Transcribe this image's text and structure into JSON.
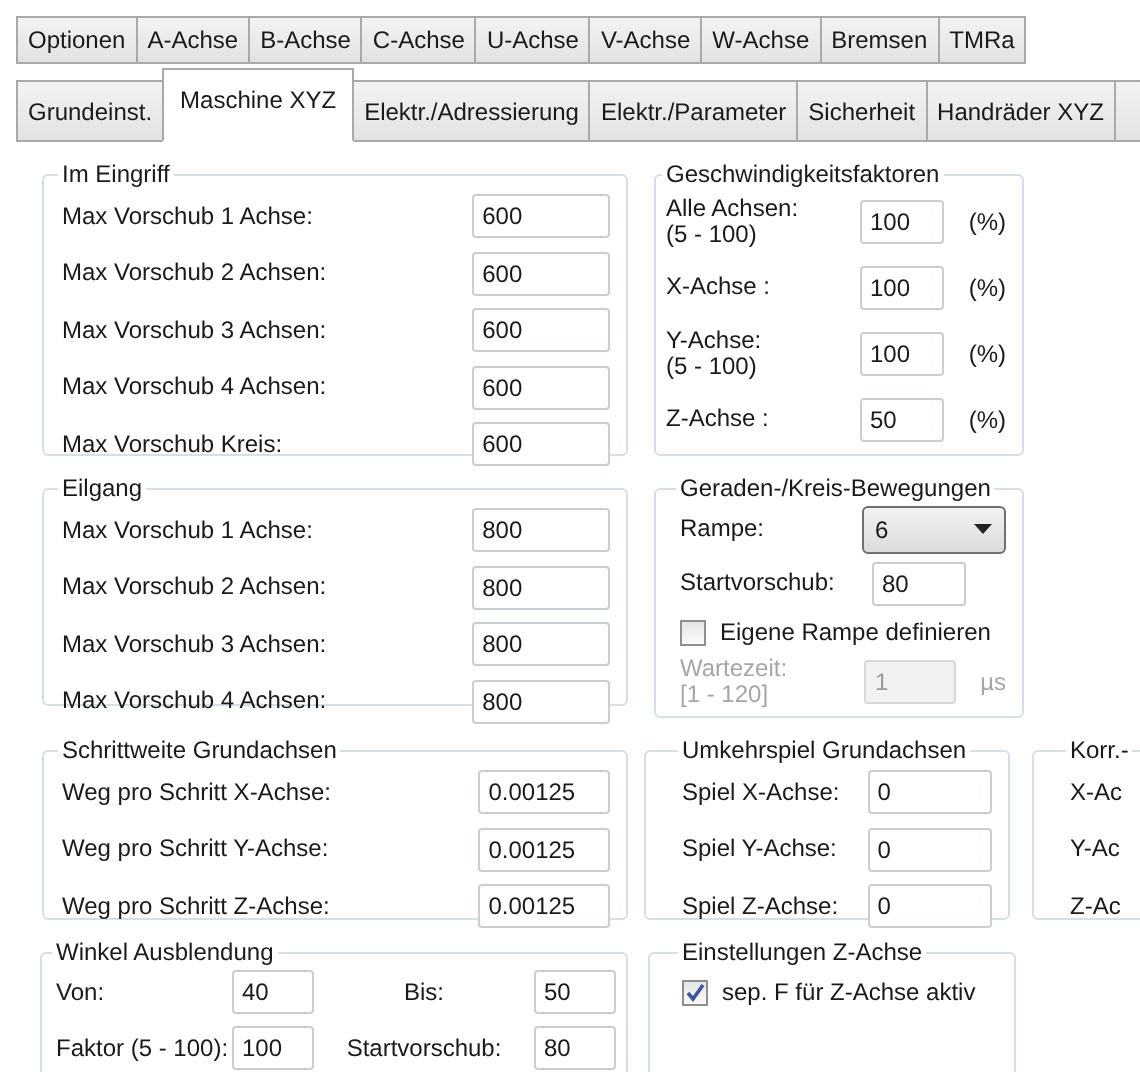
{
  "tabs_row_1": [
    {
      "label": "Optionen",
      "selected": false
    },
    {
      "label": "A-Achse",
      "selected": false
    },
    {
      "label": "B-Achse",
      "selected": false
    },
    {
      "label": "C-Achse",
      "selected": false
    },
    {
      "label": "U-Achse",
      "selected": false
    },
    {
      "label": "V-Achse",
      "selected": false
    },
    {
      "label": "W-Achse",
      "selected": false
    },
    {
      "label": "Bremsen",
      "selected": false
    },
    {
      "label": "TMRa",
      "selected": false
    }
  ],
  "tabs_row_2": [
    {
      "label": "Grundeinst.",
      "selected": false
    },
    {
      "label": "Maschine XYZ",
      "selected": true
    },
    {
      "label": "Elektr./Adressierung",
      "selected": false
    },
    {
      "label": "Elektr./Parameter",
      "selected": false
    },
    {
      "label": "Sicherheit",
      "selected": false
    },
    {
      "label": "Handräder XYZ",
      "selected": false
    }
  ],
  "groups": [
    {
      "title": "Im Eingriff",
      "fields": [
        {
          "kind": "input",
          "label": "Max Vorschub 1 Achse:",
          "value": "600"
        },
        {
          "kind": "input",
          "label": "Max Vorschub 2 Achsen:",
          "value": "600"
        },
        {
          "kind": "input",
          "label": "Max Vorschub 3 Achsen:",
          "value": "600"
        },
        {
          "kind": "input",
          "label": "Max Vorschub 4 Achsen:",
          "value": "600"
        },
        {
          "kind": "input",
          "label": "Max Vorschub Kreis:",
          "value": "600"
        }
      ]
    },
    {
      "title": "Geschwindigkeitsfaktoren",
      "fields": [
        {
          "kind": "input",
          "label": "Alle Achsen:\n(5 - 100)",
          "value": "100",
          "unit": "(%)"
        },
        {
          "kind": "input",
          "label": "X-Achse :",
          "value": "100",
          "unit": "(%)"
        },
        {
          "kind": "input",
          "label": "Y-Achse:\n(5 - 100)",
          "value": "100",
          "unit": "(%)"
        },
        {
          "kind": "input",
          "label": "Z-Achse :",
          "value": "50",
          "unit": "(%)"
        }
      ]
    },
    {
      "title": "Eilgang",
      "fields": [
        {
          "kind": "input",
          "label": "Max Vorschub 1 Achse:",
          "value": "800"
        },
        {
          "kind": "input",
          "label": "Max Vorschub 2 Achsen:",
          "value": "800"
        },
        {
          "kind": "input",
          "label": "Max Vorschub 3 Achsen:",
          "value": "800"
        },
        {
          "kind": "input",
          "label": "Max Vorschub 4 Achsen:",
          "value": "800"
        }
      ]
    },
    {
      "title": "Geraden-/Kreis-Bewegungen",
      "fields": [
        {
          "kind": "dropdown",
          "label": "Rampe:",
          "value": "6",
          "disabled": false
        },
        {
          "kind": "input",
          "label": "Startvorschub:",
          "value": "80",
          "disabled": false
        },
        {
          "kind": "checkbox",
          "label": "Eigene Rampe definieren",
          "checked": false,
          "disabled": false
        },
        {
          "kind": "input",
          "label": "Wartezeit:\n[1 - 120]",
          "value": "1",
          "unit": "µs",
          "disabled": true
        }
      ]
    },
    {
      "title": "Schrittweite Grundachsen",
      "fields": [
        {
          "kind": "input",
          "label": "Weg pro Schritt X-Achse:",
          "value": "0.00125"
        },
        {
          "kind": "input",
          "label": "Weg pro Schritt Y-Achse:",
          "value": "0.00125"
        },
        {
          "kind": "input",
          "label": "Weg pro Schritt Z-Achse:",
          "value": "0.00125"
        }
      ]
    },
    {
      "title": "Umkehrspiel Grundachsen",
      "fields": [
        {
          "kind": "input",
          "label": "Spiel X-Achse:",
          "value": "0"
        },
        {
          "kind": "input",
          "label": "Spiel Y-Achse:",
          "value": "0"
        },
        {
          "kind": "input",
          "label": "Spiel Z-Achse:",
          "value": "0"
        }
      ]
    },
    {
      "title": "Korr.-",
      "fields": [
        {
          "kind": "label",
          "label": "X-Ac"
        },
        {
          "kind": "label",
          "label": "Y-Ac"
        },
        {
          "kind": "label",
          "label": "Z-Ac"
        }
      ]
    },
    {
      "title": "Winkel Ausblendung",
      "fields": [
        {
          "kind": "input",
          "label": "Von:",
          "value": "40"
        },
        {
          "kind": "input",
          "label": "Bis:",
          "value": "50"
        },
        {
          "kind": "input",
          "label": "Faktor (5 - 100):",
          "value": "100"
        },
        {
          "kind": "input",
          "label": "Startvorschub:",
          "value": "80"
        }
      ]
    },
    {
      "title": "Einstellungen Z-Achse",
      "fields": [
        {
          "kind": "checkbox",
          "label": "sep. F für Z-Achse aktiv",
          "checked": true
        }
      ]
    }
  ]
}
